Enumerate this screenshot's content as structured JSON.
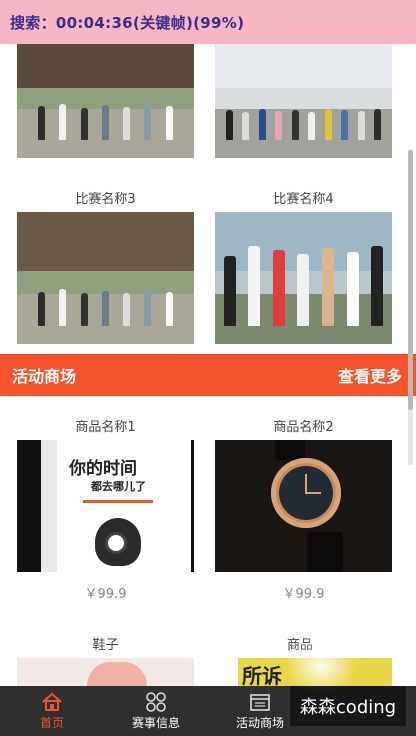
{
  "overlay": {
    "text": "搜索：00:04:36(关键帧)(99%)"
  },
  "matches": [
    {
      "caption": ""
    },
    {
      "caption": ""
    },
    {
      "caption": "比赛名称3"
    },
    {
      "caption": "比赛名称4"
    }
  ],
  "shop_section": {
    "title": "活动商场",
    "more": "查看更多"
  },
  "products": [
    {
      "name": "商品名称1",
      "price": "￥99.9",
      "book_title": "你的时间",
      "book_subtitle": "都去哪儿了"
    },
    {
      "name": "商品名称2",
      "price": "￥99.9"
    },
    {
      "name": "鞋子"
    },
    {
      "name": "商品",
      "sign_text": "所诉"
    }
  ],
  "bottom_nav": [
    {
      "label": "首页",
      "icon": "home-icon",
      "active": true
    },
    {
      "label": "赛事信息",
      "icon": "grid-icon",
      "active": false
    },
    {
      "label": "活动商场",
      "icon": "calendar-icon",
      "active": false
    },
    {
      "label": "",
      "icon": "",
      "active": false
    }
  ],
  "watermark": "森森coding",
  "colors": {
    "accent": "#f4532b",
    "nav_bg": "#2f2f2f",
    "overlay_bg": "#f4b7c3"
  }
}
